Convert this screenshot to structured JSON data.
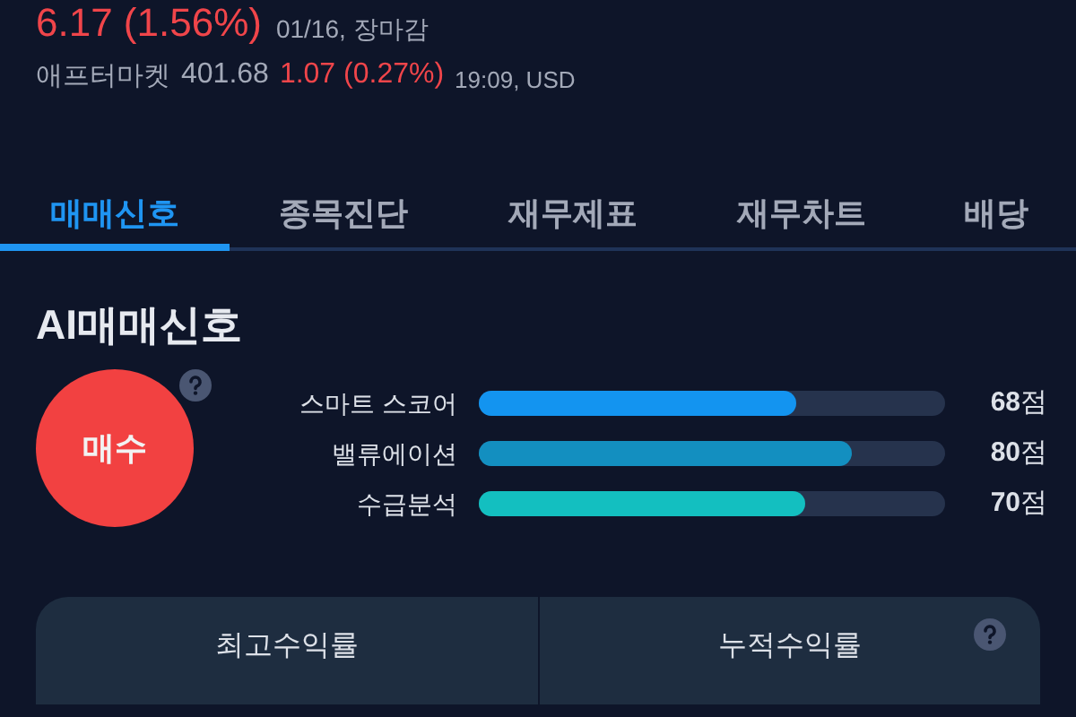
{
  "quote": {
    "change": "6.17 (1.56%)",
    "meta": "01/16, 장마감"
  },
  "after_market": {
    "label": "애프터마켓",
    "price": "401.68",
    "change": "1.07 (0.27%)",
    "meta": "19:09, USD"
  },
  "tabs": [
    {
      "label": "매매신호",
      "selected": true
    },
    {
      "label": "종목진단",
      "selected": false
    },
    {
      "label": "재무제표",
      "selected": false
    },
    {
      "label": "재무차트",
      "selected": false
    },
    {
      "label": "배당",
      "selected": false
    }
  ],
  "signal": {
    "title": "AI매매신호",
    "verdict": "매수",
    "scores": [
      {
        "label": "스마트 스코어",
        "level": 0.68,
        "color": "#1394f0",
        "score": "**68**점"
      },
      {
        "label": "밸류에이션",
        "level": 0.8,
        "color": "#138fc0",
        "score": "**80**점"
      },
      {
        "label": "수급분석",
        "level": 0.7,
        "color": "#13bfc0",
        "score": "**70**점"
      }
    ]
  },
  "returns": {
    "columns": [
      "최고수익률",
      "누적수익률"
    ]
  }
}
